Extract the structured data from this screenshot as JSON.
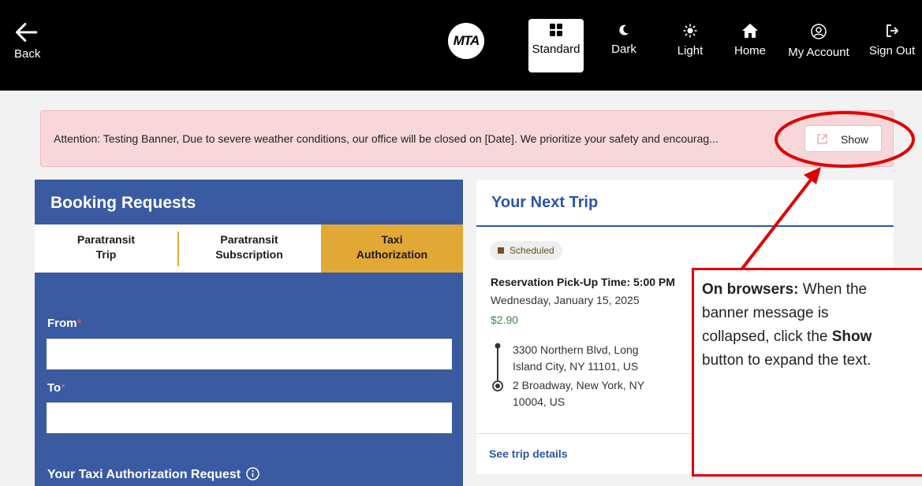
{
  "topbar": {
    "back_label": "Back",
    "logo_text": "MTA",
    "nav": [
      {
        "label": "Standard",
        "icon": "grid-icon"
      },
      {
        "label": "Dark",
        "icon": "moon-icon"
      },
      {
        "label": "Light",
        "icon": "sun-icon"
      },
      {
        "label": "Home",
        "icon": "home-icon"
      },
      {
        "label": "My Account",
        "icon": "user-circle-icon"
      },
      {
        "label": "Sign Out",
        "icon": "sign-out-icon"
      }
    ]
  },
  "banner": {
    "text": "Attention: Testing Banner, Due to severe weather conditions, our office will be closed on [Date]. We prioritize your safety and encourag...",
    "show_label": "Show"
  },
  "booking": {
    "title": "Booking Requests",
    "tabs": [
      {
        "line1": "Paratransit",
        "line2": "Trip"
      },
      {
        "line1": "Paratransit",
        "line2": "Subscription"
      },
      {
        "line1": "Taxi",
        "line2": "Authorization"
      }
    ],
    "from_label": "From",
    "to_label": "To",
    "required_mark": "*",
    "taxi_request_label": "Your Taxi Authorization Request"
  },
  "trip": {
    "title": "Your Next Trip",
    "status": "Scheduled",
    "pickup": "Reservation Pick-Up Time: 5:00 PM",
    "date": "Wednesday, January 15, 2025",
    "fare": "$2.90",
    "origin_line1": "3300 Northern Blvd, Long",
    "origin_line2": "Island City, NY 11101, US",
    "dest_line1": "2 Broadway, New York, NY",
    "dest_line2": "10004, US",
    "details_link": "See trip details"
  },
  "callout": {
    "bold1": "On browsers:",
    "line1_rest": " When the",
    "line2": "banner message is",
    "line3_pre": "collapsed, click the ",
    "bold2": "Show",
    "line4": "button to expand the text."
  },
  "colors": {
    "topbar": "#000000",
    "banner_bg": "#f7d7d9",
    "booking_bg": "#3a5ba2",
    "active_tab": "#e2a836",
    "link_blue": "#2b57a8",
    "annotation_red": "#e00000"
  }
}
